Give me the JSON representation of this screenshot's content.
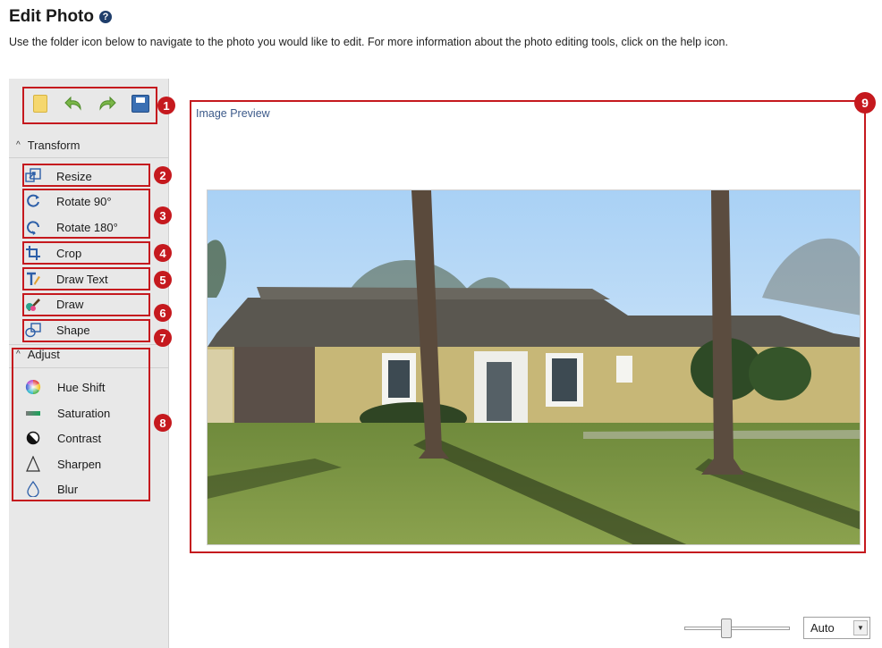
{
  "header": {
    "title": "Edit Photo",
    "help_icon": "help-icon",
    "subtitle": "Use the folder icon below to navigate to the photo you would like to edit. For more information about the photo editing tools, click on the help icon."
  },
  "toolbar": {
    "icons": [
      "folder-icon",
      "undo-icon",
      "redo-icon",
      "save-icon"
    ]
  },
  "transform": {
    "label": "Transform",
    "tools": [
      {
        "label": "Resize",
        "icon": "resize-icon"
      },
      {
        "label": "Rotate 90°",
        "icon": "rotate-90-icon"
      },
      {
        "label": "Rotate 180°",
        "icon": "rotate-180-icon"
      },
      {
        "label": "Crop",
        "icon": "crop-icon"
      },
      {
        "label": "Draw Text",
        "icon": "text-icon"
      },
      {
        "label": "Draw",
        "icon": "brush-icon"
      },
      {
        "label": "Shape",
        "icon": "shape-icon"
      }
    ]
  },
  "adjust": {
    "label": "Adjust",
    "tools": [
      {
        "label": "Hue Shift",
        "icon": "color-wheel-icon"
      },
      {
        "label": "Saturation",
        "icon": "saturation-icon"
      },
      {
        "label": "Contrast",
        "icon": "contrast-icon"
      },
      {
        "label": "Sharpen",
        "icon": "sharpen-icon"
      },
      {
        "label": "Blur",
        "icon": "blur-drop-icon"
      }
    ]
  },
  "callouts": [
    "1",
    "2",
    "3",
    "4",
    "5",
    "6",
    "7",
    "8",
    "9"
  ],
  "preview": {
    "label": "Image Preview"
  },
  "zoom": {
    "value": "Auto",
    "slider_level": 0.35
  },
  "colors": {
    "callout_red": "#c5191e",
    "sidebar_bg": "#e8e8e8",
    "preview_label": "#3c5a8a"
  }
}
